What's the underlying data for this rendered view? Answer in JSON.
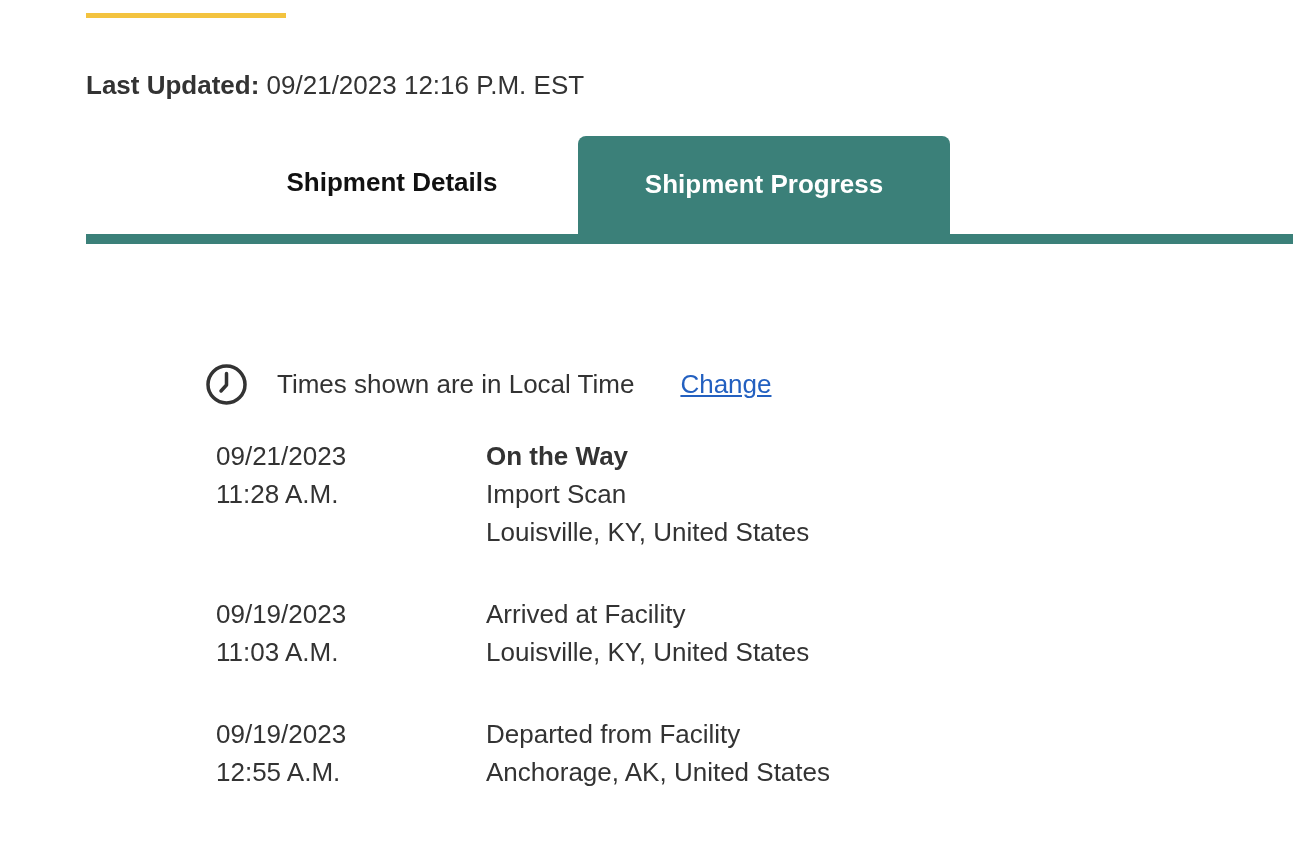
{
  "last_updated": {
    "label": "Last Updated:",
    "value": "09/21/2023 12:16 P.M. EST"
  },
  "tabs": [
    {
      "label": "Shipment Details",
      "selected": false
    },
    {
      "label": "Shipment Progress",
      "selected": true
    }
  ],
  "time_notice": {
    "text": "Times shown are in Local Time",
    "link": "Change"
  },
  "events": [
    {
      "date": "09/21/2023",
      "time": "11:28 A.M.",
      "status": "On the Way",
      "activity": "Import Scan",
      "location": "Louisville, KY, United States"
    },
    {
      "date": "09/19/2023",
      "time": "11:03 A.M.",
      "activity": "Arrived at Facility",
      "location": "Louisville, KY, United States"
    },
    {
      "date": "09/19/2023",
      "time": "12:55 A.M.",
      "activity": "Departed from Facility",
      "location": "Anchorage, AK, United States"
    }
  ]
}
